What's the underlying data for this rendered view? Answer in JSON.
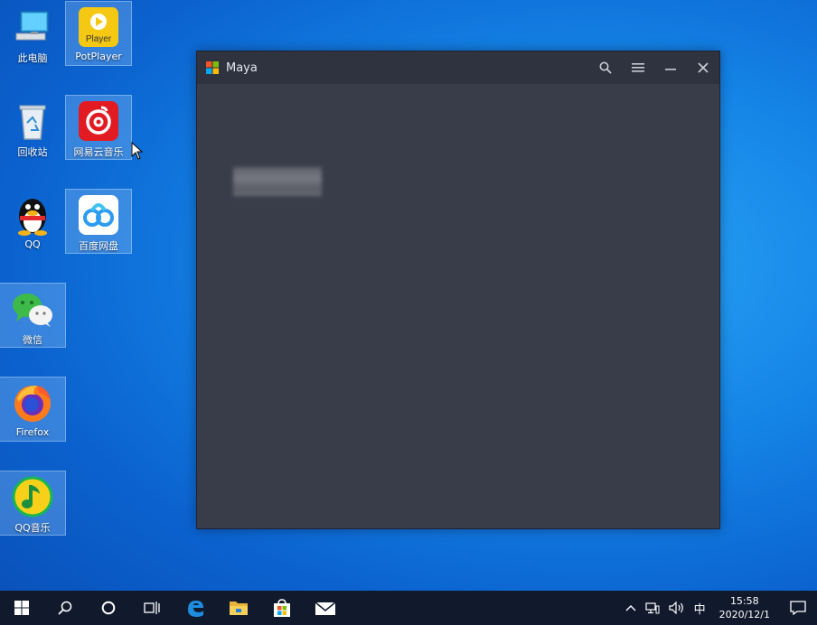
{
  "desktop": {
    "icons": [
      {
        "label": "此电脑"
      },
      {
        "label": "PotPlayer",
        "badge": "Player"
      },
      {
        "label": "回收站"
      },
      {
        "label": "网易云音乐"
      },
      {
        "label": "QQ"
      },
      {
        "label": "百度网盘"
      },
      {
        "label": "微信"
      },
      {
        "label": "Firefox"
      },
      {
        "label": "QQ音乐"
      }
    ]
  },
  "window": {
    "title": "Maya",
    "controls": [
      "search-icon",
      "menu-icon",
      "minimize-icon",
      "close-icon"
    ]
  },
  "taskbar": {
    "items": [
      "windows-start-icon",
      "search-icon",
      "cortana-icon",
      "task-view-icon",
      "edge-icon",
      "file-explorer-icon",
      "store-icon",
      "mail-icon"
    ],
    "ime": "中",
    "time": "15:58",
    "date": "2020/12/1"
  },
  "colors": {
    "window_bg": "#393d4a",
    "titlebar_bg": "#2f3340",
    "taskbar_bg": "#111a2c",
    "desktop_accent": "#1483e6"
  }
}
